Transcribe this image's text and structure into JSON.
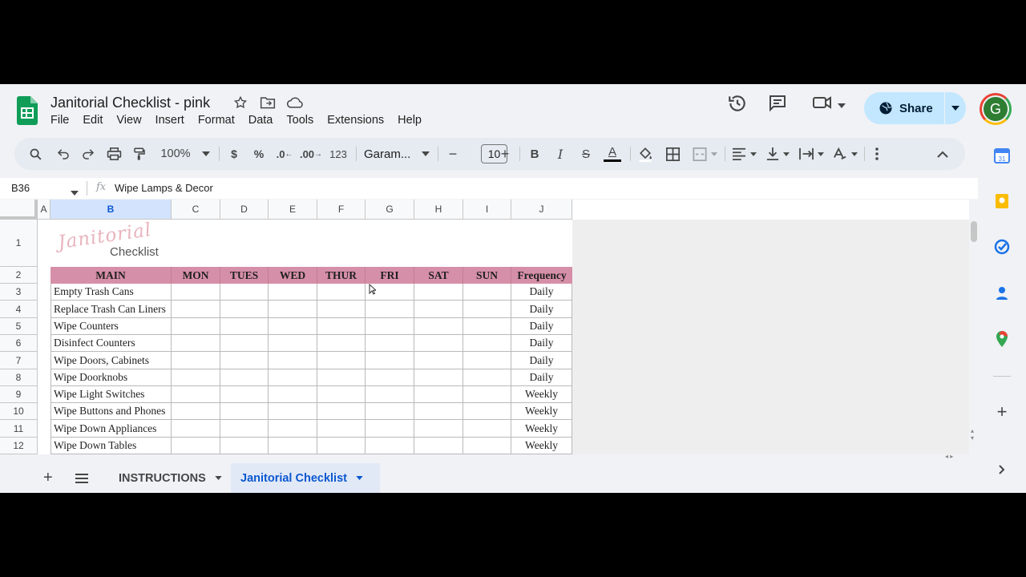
{
  "doc": {
    "title": "Janitorial Checklist - pink"
  },
  "menu": [
    "File",
    "Edit",
    "View",
    "Insert",
    "Format",
    "Data",
    "Tools",
    "Extensions",
    "Help"
  ],
  "share": {
    "label": "Share"
  },
  "avatar": {
    "initial": "G"
  },
  "toolbar": {
    "zoom": "100%",
    "currency": "$",
    "percent": "%",
    "dec_decrease": ".0",
    "dec_increase": ".00",
    "number_format": "123",
    "font": "Garam...",
    "font_size": "10",
    "bold": "B",
    "italic": "I",
    "strike": "S",
    "text_color": "A"
  },
  "formula_bar": {
    "cell_ref": "B36",
    "fx": "fx",
    "content": "Wipe Lamps & Decor"
  },
  "grid": {
    "columns": [
      "A",
      "B",
      "C",
      "D",
      "E",
      "F",
      "G",
      "H",
      "I",
      "J"
    ],
    "selected_column": "B",
    "rows": [
      "1",
      "2",
      "3",
      "4",
      "5",
      "6",
      "7",
      "8",
      "9",
      "10",
      "11",
      "12"
    ],
    "logo_script": "Janitorial",
    "logo_word": "Checklist",
    "header": [
      "MAIN",
      "MON",
      "TUES",
      "WED",
      "THUR",
      "FRI",
      "SAT",
      "SUN",
      "Frequency"
    ],
    "tasks": [
      {
        "task": "Empty Trash Cans",
        "freq": "Daily"
      },
      {
        "task": "Replace Trash Can Liners",
        "freq": "Daily"
      },
      {
        "task": "Wipe Counters",
        "freq": "Daily"
      },
      {
        "task": "Disinfect Counters",
        "freq": "Daily"
      },
      {
        "task": "Wipe Doors, Cabinets",
        "freq": "Daily"
      },
      {
        "task": "Wipe Doorknobs",
        "freq": "Daily"
      },
      {
        "task": "Wipe Light Switches",
        "freq": "Weekly"
      },
      {
        "task": "Wipe Buttons and Phones",
        "freq": "Weekly"
      },
      {
        "task": "Wipe Down Appliances",
        "freq": "Weekly"
      },
      {
        "task": "Wipe Down Tables",
        "freq": "Weekly"
      }
    ]
  },
  "sheet_tabs": [
    {
      "label": "INSTRUCTIONS",
      "active": false
    },
    {
      "label": "Janitorial Checklist",
      "active": true
    }
  ],
  "colors": {
    "header_pink": "#d68fa8",
    "share_bg": "#c2e7ff",
    "active_tab": "#0b57d0"
  }
}
